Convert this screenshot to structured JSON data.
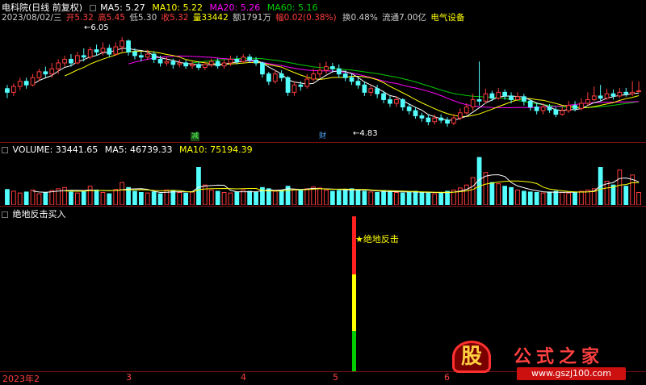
{
  "stock_header": {
    "name": "电科院",
    "mode": "(日线 前复权)",
    "ma5": "MA5: 5.27",
    "ma10": "MA10: 5.22",
    "ma20": "MA20: 5.26",
    "ma60": "MA60: 5.16"
  },
  "bar_info": {
    "date": "2023/08/02/三",
    "open": "开5.32",
    "high": "高5.45",
    "low": "低5.30",
    "close": "收5.32",
    "volume": "量33442",
    "amount": "额1791万",
    "change": "幅0.02(0.38%)",
    "turnover": "换0.48%",
    "float_value": "流通7.00亿",
    "sector": "电气设备"
  },
  "annotations": {
    "high_label": "6.05",
    "low_label": "4.83",
    "reduce_tag": "减",
    "finance_tag": "财"
  },
  "volume_header": {
    "volume": "VOLUME: 33441.65",
    "ma5": "MA5: 46739.33",
    "ma10": "MA10: 75194.39"
  },
  "indicator": {
    "title": "绝地反击买入",
    "signal_label": "绝地反击"
  },
  "x_axis": {
    "labels": [
      "2023年2",
      "3",
      "4",
      "5",
      "6"
    ]
  },
  "watermark": {
    "logo_char": "股",
    "brand": "公式之家",
    "url": "www.gszj100.com"
  },
  "colors": {
    "up": "#ff3c3c",
    "down": "#54ffff",
    "ma5": "#ffffff",
    "ma10": "#ffff00",
    "ma20": "#ff00ff",
    "ma60": "#00cc00",
    "separator": "#7a1010"
  },
  "chart_data": {
    "type": "candlestick",
    "price_range": [
      4.6,
      6.25
    ],
    "candles": [
      [
        5.35,
        5.3,
        5.4,
        5.22
      ],
      [
        5.3,
        5.38,
        5.42,
        5.25
      ],
      [
        5.38,
        5.45,
        5.5,
        5.33
      ],
      [
        5.45,
        5.4,
        5.5,
        5.35
      ],
      [
        5.4,
        5.5,
        5.55,
        5.38
      ],
      [
        5.5,
        5.58,
        5.62,
        5.45
      ],
      [
        5.58,
        5.55,
        5.65,
        5.5
      ],
      [
        5.55,
        5.62,
        5.7,
        5.5
      ],
      [
        5.62,
        5.7,
        5.75,
        5.55
      ],
      [
        5.7,
        5.75,
        5.8,
        5.65
      ],
      [
        5.75,
        5.7,
        5.82,
        5.65
      ],
      [
        5.7,
        5.8,
        5.85,
        5.68
      ],
      [
        5.8,
        5.78,
        5.9,
        5.72
      ],
      [
        5.78,
        5.88,
        5.92,
        5.75
      ],
      [
        5.88,
        5.85,
        5.95,
        5.8
      ],
      [
        5.85,
        5.9,
        5.98,
        5.8
      ],
      [
        5.9,
        5.82,
        5.95,
        5.78
      ],
      [
        5.82,
        5.92,
        5.98,
        5.8
      ],
      [
        5.92,
        6.0,
        6.05,
        5.85
      ],
      [
        6.0,
        5.85,
        6.02,
        5.8
      ],
      [
        5.85,
        5.8,
        5.9,
        5.75
      ],
      [
        5.8,
        5.78,
        5.85,
        5.72
      ],
      [
        5.78,
        5.82,
        5.88,
        5.74
      ],
      [
        5.82,
        5.75,
        5.86,
        5.7
      ],
      [
        5.75,
        5.7,
        5.8,
        5.65
      ],
      [
        5.7,
        5.72,
        5.78,
        5.66
      ],
      [
        5.72,
        5.68,
        5.76,
        5.62
      ],
      [
        5.68,
        5.7,
        5.75,
        5.64
      ],
      [
        5.7,
        5.66,
        5.74,
        5.62
      ],
      [
        5.66,
        5.68,
        5.72,
        5.62
      ],
      [
        5.68,
        5.64,
        5.72,
        5.6
      ],
      [
        5.64,
        5.68,
        5.72,
        5.6
      ],
      [
        5.68,
        5.72,
        5.76,
        5.64
      ],
      [
        5.72,
        5.66,
        5.76,
        5.62
      ],
      [
        5.66,
        5.7,
        5.74,
        5.62
      ],
      [
        5.7,
        5.75,
        5.8,
        5.66
      ],
      [
        5.75,
        5.72,
        5.8,
        5.68
      ],
      [
        5.72,
        5.78,
        5.82,
        5.7
      ],
      [
        5.78,
        5.74,
        5.82,
        5.7
      ],
      [
        5.74,
        5.7,
        5.78,
        5.66
      ],
      [
        5.7,
        5.55,
        5.72,
        5.5
      ],
      [
        5.55,
        5.45,
        5.58,
        5.4
      ],
      [
        5.45,
        5.55,
        5.6,
        5.42
      ],
      [
        5.55,
        5.5,
        5.6,
        5.45
      ],
      [
        5.5,
        5.3,
        5.52,
        5.25
      ],
      [
        5.3,
        5.4,
        5.45,
        5.25
      ],
      [
        5.4,
        5.38,
        5.45,
        5.32
      ],
      [
        5.38,
        5.48,
        5.55,
        5.35
      ],
      [
        5.48,
        5.55,
        5.62,
        5.45
      ],
      [
        5.55,
        5.6,
        5.7,
        5.5
      ],
      [
        5.6,
        5.65,
        5.72,
        5.55
      ],
      [
        5.65,
        5.62,
        5.7,
        5.58
      ],
      [
        5.62,
        5.55,
        5.68,
        5.5
      ],
      [
        5.55,
        5.5,
        5.6,
        5.45
      ],
      [
        5.5,
        5.45,
        5.55,
        5.4
      ],
      [
        5.45,
        5.4,
        5.5,
        5.35
      ],
      [
        5.4,
        5.3,
        5.45,
        5.25
      ],
      [
        5.3,
        5.35,
        5.4,
        5.25
      ],
      [
        5.35,
        5.28,
        5.4,
        5.22
      ],
      [
        5.28,
        5.2,
        5.32,
        5.15
      ],
      [
        5.2,
        5.15,
        5.25,
        5.1
      ],
      [
        5.15,
        5.2,
        5.25,
        5.1
      ],
      [
        5.2,
        5.1,
        5.22,
        5.05
      ],
      [
        5.1,
        5.05,
        5.15,
        5.0
      ],
      [
        5.05,
        4.98,
        5.1,
        4.94
      ],
      [
        4.98,
        4.95,
        5.02,
        4.9
      ],
      [
        4.95,
        4.9,
        5.0,
        4.85
      ],
      [
        4.9,
        4.95,
        5.0,
        4.86
      ],
      [
        4.95,
        4.92,
        5.0,
        4.88
      ],
      [
        4.92,
        4.88,
        4.96,
        4.83
      ],
      [
        4.88,
        4.95,
        5.0,
        4.85
      ],
      [
        4.95,
        5.02,
        5.08,
        4.92
      ],
      [
        5.02,
        5.1,
        5.15,
        5.0
      ],
      [
        5.1,
        5.2,
        5.28,
        5.05
      ],
      [
        5.2,
        5.18,
        5.72,
        5.12
      ],
      [
        5.18,
        5.28,
        5.35,
        5.15
      ],
      [
        5.28,
        5.22,
        5.32,
        5.18
      ],
      [
        5.22,
        5.3,
        5.36,
        5.2
      ],
      [
        5.3,
        5.25,
        5.34,
        5.2
      ],
      [
        5.25,
        5.2,
        5.3,
        5.15
      ],
      [
        5.2,
        5.24,
        5.3,
        5.18
      ],
      [
        5.24,
        5.18,
        5.28,
        5.12
      ],
      [
        5.18,
        5.1,
        5.2,
        5.05
      ],
      [
        5.1,
        5.05,
        5.15,
        5.0
      ],
      [
        5.05,
        5.1,
        5.15,
        5.0
      ],
      [
        5.1,
        5.06,
        5.14,
        5.02
      ],
      [
        5.06,
        5.0,
        5.1,
        4.96
      ],
      [
        5.0,
        5.05,
        5.1,
        4.98
      ],
      [
        5.05,
        5.12,
        5.18,
        5.02
      ],
      [
        5.12,
        5.08,
        5.18,
        5.04
      ],
      [
        5.08,
        5.15,
        5.22,
        5.05
      ],
      [
        5.15,
        5.2,
        5.3,
        5.12
      ],
      [
        5.2,
        5.25,
        5.38,
        5.18
      ],
      [
        5.25,
        5.22,
        5.4,
        5.18
      ],
      [
        5.22,
        5.28,
        5.35,
        5.2
      ],
      [
        5.28,
        5.25,
        5.34,
        5.2
      ],
      [
        5.25,
        5.3,
        5.36,
        5.22
      ],
      [
        5.3,
        5.28,
        5.36,
        5.24
      ],
      [
        5.28,
        5.3,
        5.45,
        5.25
      ],
      [
        5.32,
        5.32,
        5.45,
        5.3
      ]
    ],
    "volume_range": [
      0,
      200000
    ],
    "volumes": [
      62000,
      55000,
      48000,
      52000,
      60000,
      45000,
      50000,
      58000,
      65000,
      70000,
      52000,
      48000,
      55000,
      75000,
      60000,
      50000,
      45000,
      62000,
      90000,
      70000,
      55000,
      50000,
      48000,
      52000,
      45000,
      60000,
      58000,
      50000,
      47000,
      52000,
      150000,
      80000,
      60000,
      55000,
      50000,
      48000,
      52000,
      60000,
      55000,
      50000,
      70000,
      65000,
      55000,
      60000,
      75000,
      62000,
      58000,
      65000,
      72000,
      68000,
      60000,
      55000,
      58000,
      62000,
      65000,
      60000,
      55000,
      52000,
      50000,
      58000,
      55000,
      50000,
      48000,
      52000,
      55000,
      50000,
      48000,
      45000,
      50000,
      55000,
      60000,
      68000,
      80000,
      110000,
      190000,
      130000,
      90000,
      85000,
      75000,
      70000,
      60000,
      55000,
      52000,
      50000,
      48000,
      52000,
      55000,
      50000,
      48000,
      52000,
      55000,
      60000,
      65000,
      150000,
      95000,
      80000,
      140000,
      75000,
      120000,
      50000
    ]
  }
}
